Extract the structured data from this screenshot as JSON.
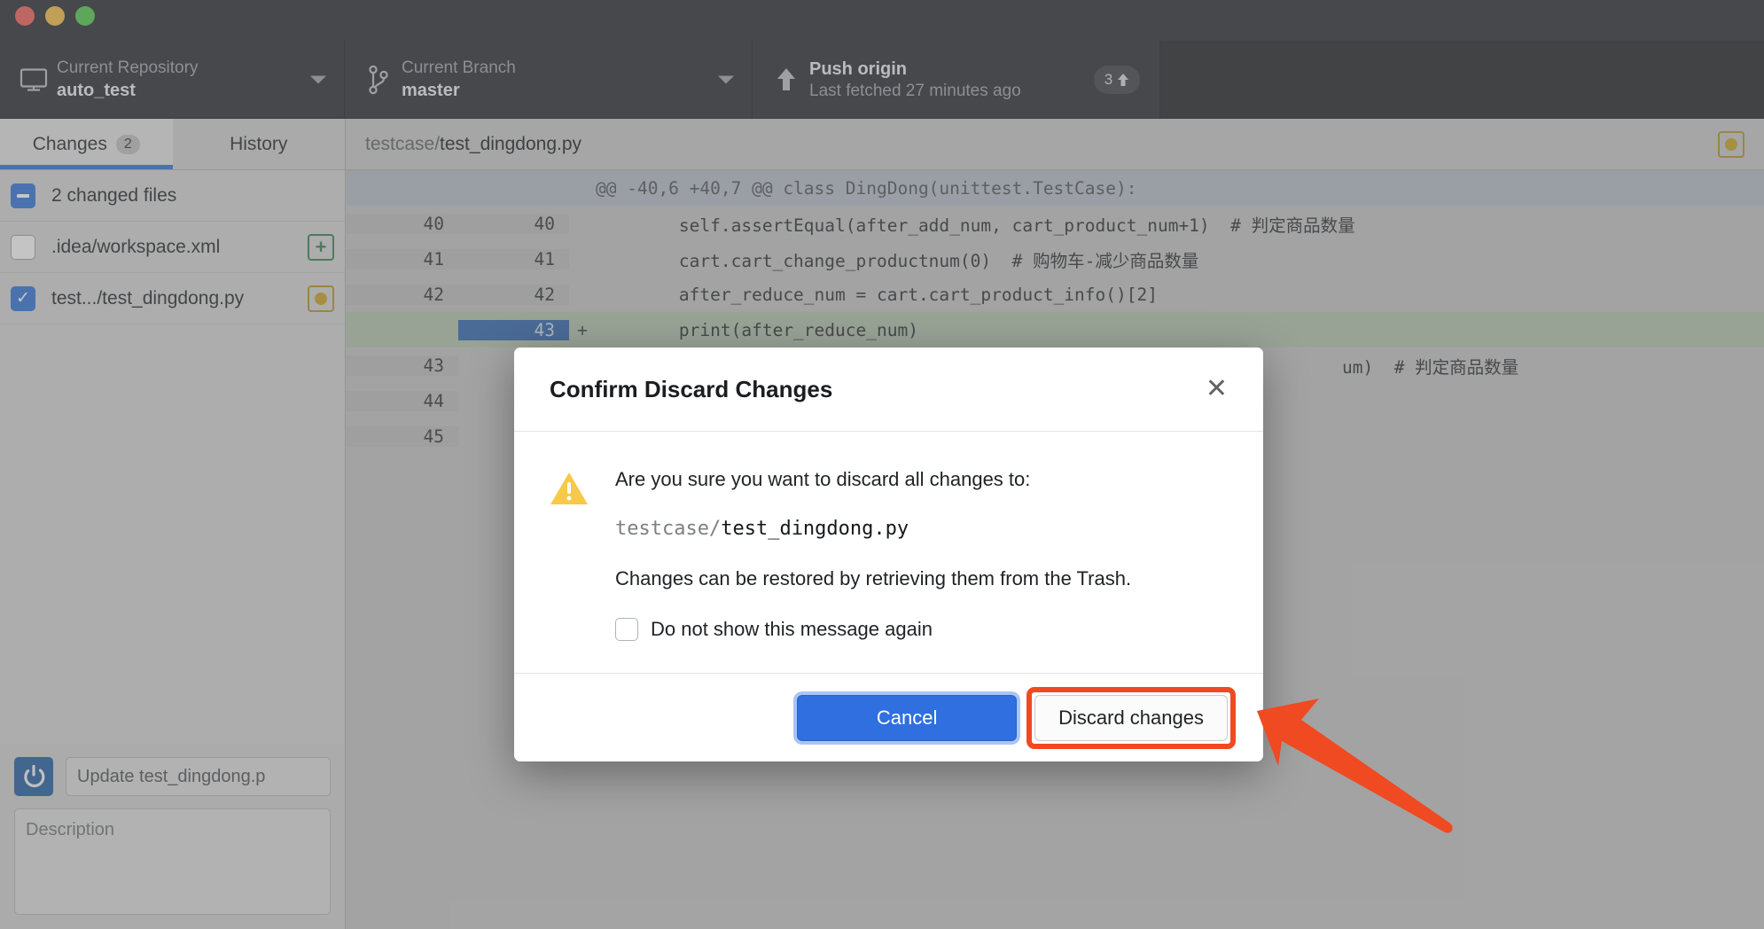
{
  "window": {
    "traffic_lights": [
      "close",
      "minimize",
      "zoom"
    ]
  },
  "toolbar": {
    "repository": {
      "label": "Current Repository",
      "value": "auto_test",
      "icon": "monitor-icon",
      "caret": "chevron-down-icon"
    },
    "branch": {
      "label": "Current Branch",
      "value": "master",
      "icon": "branch-icon",
      "caret": "chevron-down-icon"
    },
    "push": {
      "label": "Push origin",
      "sub": "Last fetched 27 minutes ago",
      "badge_count": "3",
      "badge_arrow": "▲",
      "icon": "arrow-up-icon"
    }
  },
  "sidebar": {
    "tabs": [
      {
        "label": "Changes",
        "count": "2",
        "active": true
      },
      {
        "label": "History",
        "count": "",
        "active": false
      }
    ],
    "changed_header": "2 changed files",
    "files": [
      {
        "name": ".idea/workspace.xml",
        "checked": false,
        "status": "added"
      },
      {
        "name": "test.../test_dingdong.py",
        "checked": true,
        "status": "modified"
      }
    ],
    "commit": {
      "summary_value": "Update test_dingdong.p",
      "description_placeholder": "Description"
    }
  },
  "diff": {
    "header_dir": "testcase/",
    "header_file": "test_dingdong.py",
    "status_badge": "modified-badge",
    "lines": [
      {
        "type": "hunk",
        "old": "",
        "new": "",
        "sign": "",
        "code": "@@ -40,6 +40,7 @@ class DingDong(unittest.TestCase):"
      },
      {
        "type": "ctx",
        "old": "40",
        "new": "40",
        "sign": "",
        "code": "        self.assertEqual(after_add_num, cart_product_num+1)  # 判定商品数量"
      },
      {
        "type": "ctx",
        "old": "41",
        "new": "41",
        "sign": "",
        "code": "        cart.cart_change_productnum(0)  # 购物车-减少商品数量"
      },
      {
        "type": "ctx",
        "old": "42",
        "new": "42",
        "sign": "",
        "code": "        after_reduce_num = cart.cart_product_info()[2]"
      },
      {
        "type": "add",
        "old": "",
        "new": "43",
        "sign": "+",
        "code": "        print(after_reduce_num)"
      },
      {
        "type": "ctx",
        "old": "43",
        "new": "",
        "sign": "",
        "code": "um)  # 判定商品数量"
      },
      {
        "type": "ctx",
        "old": "44",
        "new": "",
        "sign": "",
        "code": ""
      },
      {
        "type": "ctx",
        "old": "45",
        "new": "",
        "sign": "",
        "code": ""
      }
    ]
  },
  "dialog": {
    "title": "Confirm Discard Changes",
    "close_icon": "✕",
    "warning_icon": "warning-triangle-icon",
    "question": "Are you sure you want to discard all changes to:",
    "path_dir": "testcase/",
    "path_file": "test_dingdong.py",
    "note": "Changes can be restored by retrieving them from the Trash.",
    "dont_show_label": "Do not show this message again",
    "dont_show_checked": false,
    "cancel_label": "Cancel",
    "discard_label": "Discard changes"
  },
  "annotation": {
    "color": "#ef4a22",
    "target": "discard-changes-button"
  },
  "colors": {
    "accent_blue": "#2a6fd6",
    "toolbar_bg": "#24262b",
    "annotation_red": "#ef4a22",
    "added_line_bg": "#b0c3ad",
    "modified_yellow": "#c8a01c",
    "added_green": "#2f7d4f"
  }
}
